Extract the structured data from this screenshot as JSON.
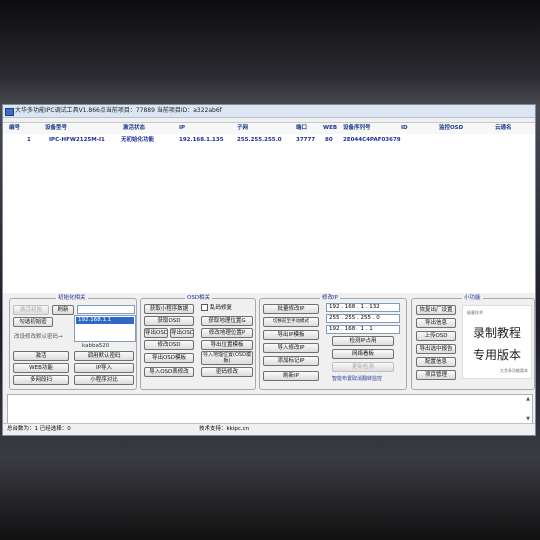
{
  "window": {
    "title": "大华多功能IPC调试工具V1.866点当前项目：77889  当前项目ID：a322ab6f"
  },
  "table": {
    "headers": [
      "编号",
      "设备型号",
      "激活状态",
      "IP",
      "子网",
      "端口",
      "WEB",
      "设备序列号",
      "ID",
      "监控OSD",
      "云通名"
    ],
    "rows": [
      [
        "1",
        "IPC-HFW2125M-I1",
        "无初始化功能",
        "192.168.1.135",
        "255.255.255.0",
        "37777",
        "80",
        "2E044C4PAF03679",
        "",
        "",
        ""
      ]
    ]
  },
  "init_panel": {
    "title": "初始化相关",
    "btn_init": "激活初始",
    "btn_refresh": "刷新",
    "chk_select": "勾选初始密",
    "dropdown_selected": "192.168.1.1",
    "dropdown_option2": "",
    "hint_default_pwd": "改设修改默认密码→",
    "password_value": "kabba520",
    "btn_activate": "激活",
    "btn_call_default_pwd": "调用默认密码",
    "btn_web": "WEB功能",
    "btn_ip_import": "IP导入",
    "btn_multi_net": "多网段扫",
    "btn_mini_program": "小程序对比"
  },
  "osd_panel": {
    "title": "OSD相关",
    "btn_get_mini_data": "获取小程序数据",
    "chk_reorder": "乱码修复",
    "btn_get_osd": "获取OSD",
    "btn_get_position": "获取地理位置G",
    "btn_export_osd_small": "导出OSD",
    "btn_import_osd_mid": "导出OSD中P",
    "btn_modify_position": "修改地理位置P",
    "btn_modify_osd": "修改OSD",
    "btn_export_position_tpl": "导出位置模板",
    "btn_export_osd_tpl": "导出OSD模板",
    "btn_import_position_tpl": "导入地理位置(OSD模板)",
    "btn_import_osd_modify": "导入OSD表修改",
    "btn_pwd_change": "密码修改"
  },
  "ip_panel": {
    "title": "修改IP",
    "btn_batch_modify_ip": "批量修改IP",
    "btn_switch_mode": "切换前至手动模式",
    "btn_export_ip_tpl": "导出IP模板",
    "btn_import_modify_ip": "导入修改IP",
    "btn_add_mark_ip": "添加标记IP",
    "btn_refresh_ip": "刷新IP",
    "ip_value": "192 . 168 . 1 . 132",
    "mask_value": "255 . 255 . 255 . 0",
    "gateway_value": "192 . 168 . 1 . 1",
    "btn_check_ip_use": "检测IP占用",
    "btn_network_scan": "网络看板",
    "btn_update_check": "更新检测",
    "footer_link": "智能布置取消翻转监控"
  },
  "misc_panel": {
    "title": "小功能",
    "btn_restore_factory": "恢复出厂设置",
    "btn_export_info": "导出信息",
    "btn_upload_osd": "上传OSD",
    "btn_export_report": "导出选中报告",
    "btn_config_check": "配置信息",
    "btn_batch_manage": "项目管理",
    "logo_top": "极客技术",
    "logo_line1": "录制教程",
    "logo_line2": "专用版本",
    "logo_bottom": "大华多功能版本"
  },
  "status": {
    "left": "总台数为：1  已经选择：0",
    "center": "技术支持：kkipc.cn"
  }
}
